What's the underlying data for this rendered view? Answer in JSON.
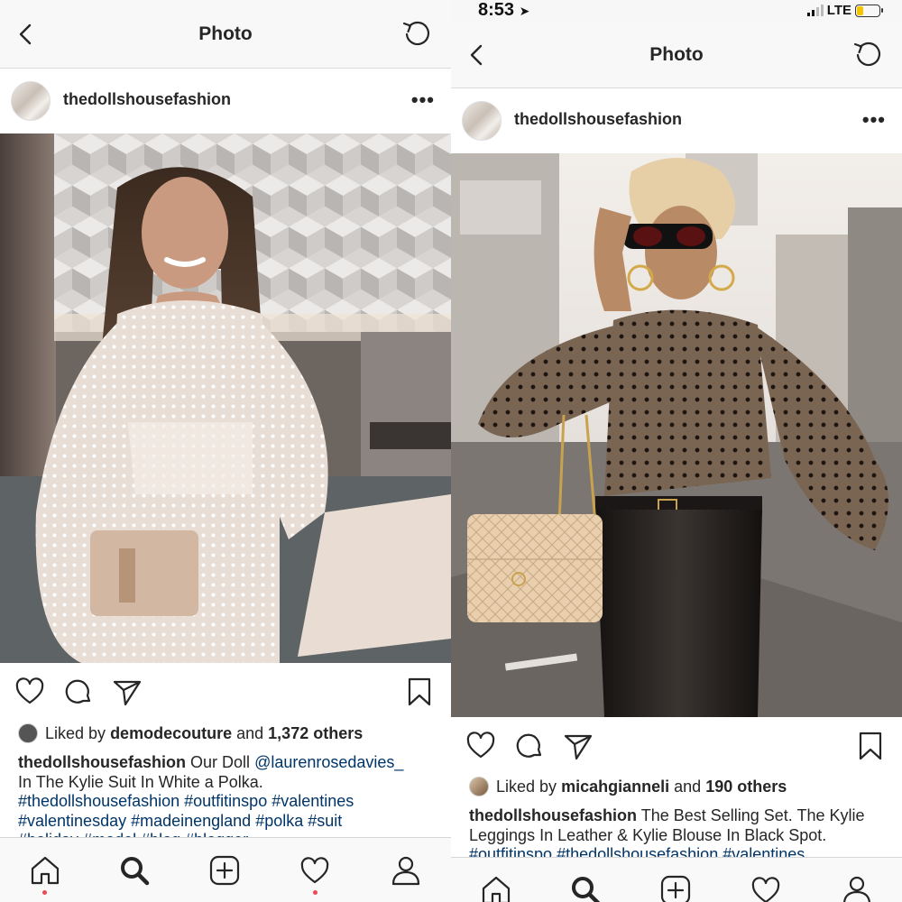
{
  "status_bar": {
    "time": "8:53",
    "carrier": "LTE"
  },
  "left_post": {
    "nav_title": "Photo",
    "username": "thedollshousefashion",
    "likes": {
      "prefix": "Liked by",
      "liker": "demodecouture",
      "middle": "and",
      "others": "1,372 others"
    },
    "caption": {
      "user": "thedollshousefashion",
      "text1": "Our Doll",
      "mention": "@laurenrosedavies_",
      "text2": "In The Kylie Suit In White a Polka.",
      "tags_line1": "#thedollshousefashion #outfitinspo #valentines",
      "tags_line2": "#valentinesday #madeinengland #polka #suit",
      "tags_line3": "#holiday #model #blog #blogger"
    }
  },
  "right_post": {
    "nav_title": "Photo",
    "username": "thedollshousefashion",
    "likes": {
      "prefix": "Liked by",
      "liker": "micahgianneli",
      "middle": "and",
      "others": "190 others"
    },
    "caption": {
      "user": "thedollshousefashion",
      "text": "The Best Selling Set. The Kylie Leggings In Leather & Kylie Blouse In Black Spot.",
      "tags_line1": "#outfitinspo #thedollshousefashion #valentines"
    }
  },
  "icons": [
    "back-icon",
    "refresh-icon",
    "more-icon",
    "heart-icon",
    "comment-icon",
    "share-icon",
    "bookmark-icon",
    "home-icon",
    "search-icon",
    "add-icon",
    "activity-icon",
    "profile-icon"
  ],
  "colors": {
    "link": "#003569",
    "text": "#262626",
    "notification_dot": "#ed4956",
    "bar_bg": "#f8f8f8"
  }
}
